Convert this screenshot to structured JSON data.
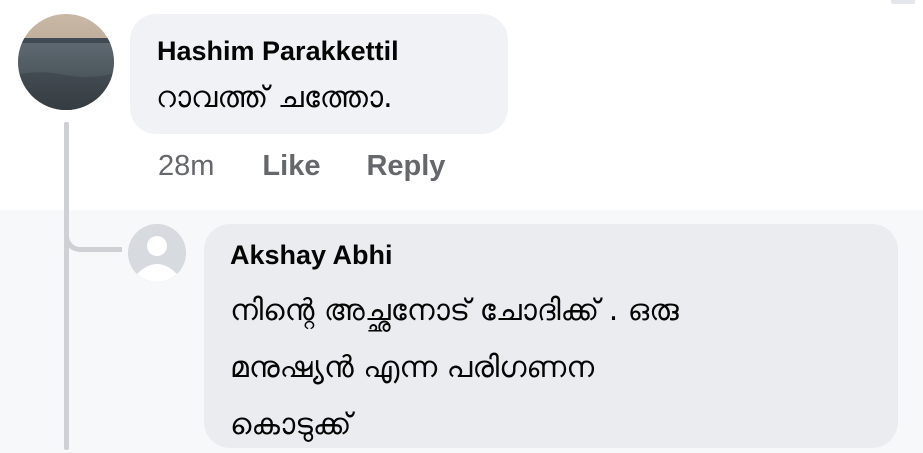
{
  "main_comment": {
    "author": "Hashim Parakkettil",
    "text": "റാവത്ത് ചത്തോ.",
    "timestamp": "28m",
    "like_label": "Like",
    "reply_label": "Reply",
    "avatar_icon": "profile-photo"
  },
  "reply_comment": {
    "author": "Akshay Abhi",
    "text_lines": [
      "നിന്റെ അച്ഛനോട് ചോദിക്ക് . ഒരു",
      "മനുഷ്യൻ എന്ന പരിഗണന",
      "കൊടുക്ക്"
    ],
    "avatar_icon": "default-avatar-icon"
  },
  "colors": {
    "page_background": "#f7f8fa",
    "bubble_background": "#f0f2f5",
    "action_text": "#65676b",
    "thread_line": "#ced0d4"
  }
}
